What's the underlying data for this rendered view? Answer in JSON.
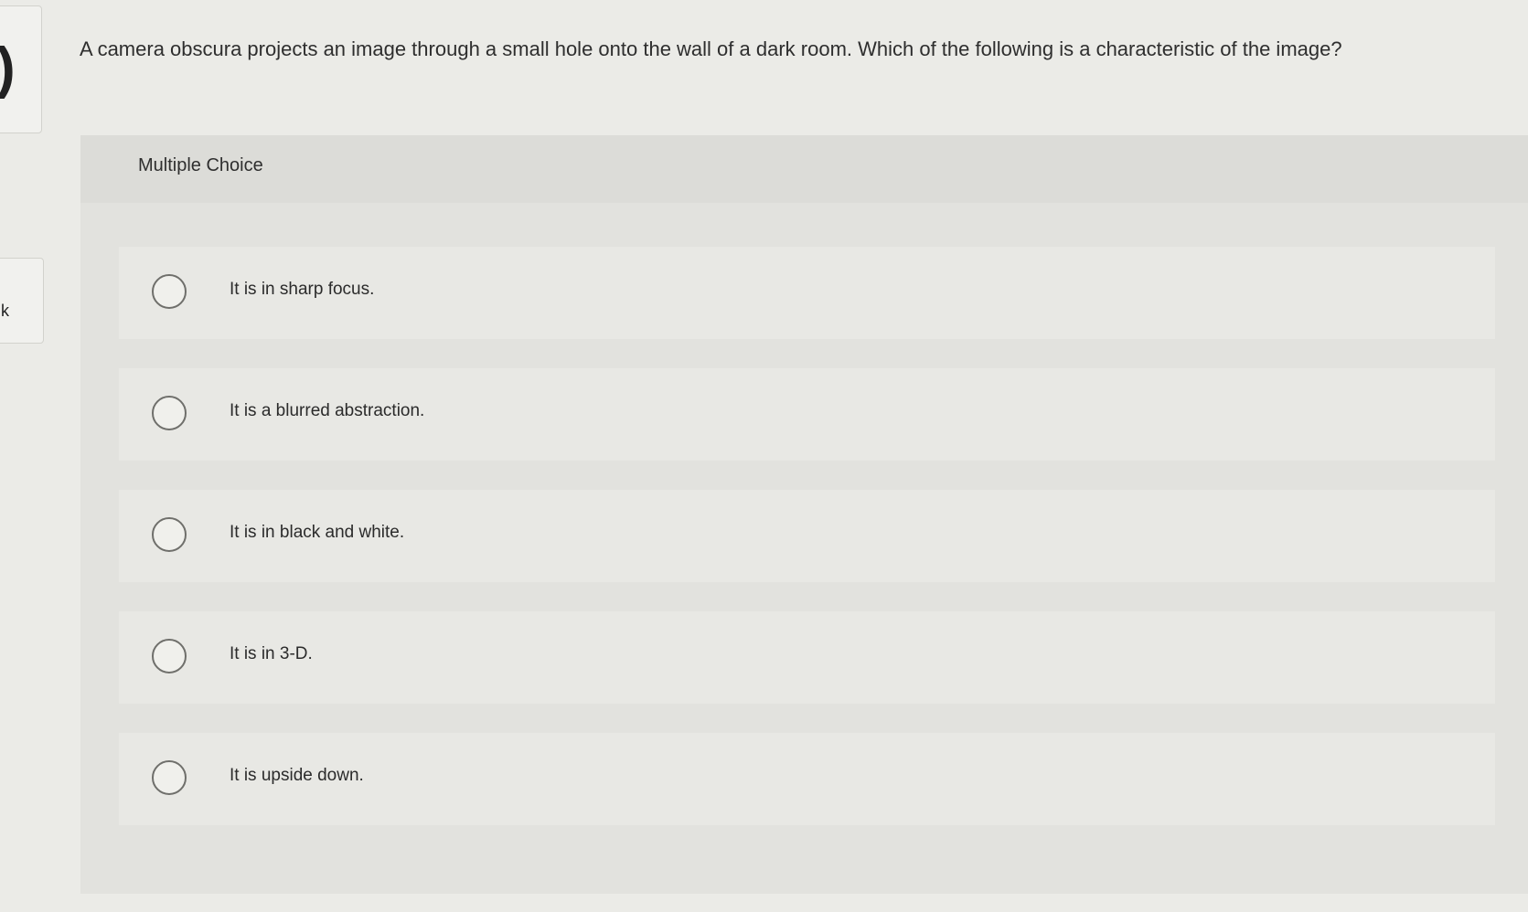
{
  "edge": {
    "top_glyph": ")",
    "mid_glyph": "k"
  },
  "question": {
    "text": "A camera obscura projects an image through a small hole onto the wall of a dark room.  Which of the following is a characteristic of the image?"
  },
  "multiple_choice": {
    "label": "Multiple Choice",
    "options": [
      {
        "label": "It is in sharp focus."
      },
      {
        "label": "It is a blurred abstraction."
      },
      {
        "label": "It is in black and white."
      },
      {
        "label": "It is in 3-D."
      },
      {
        "label": "It is upside down."
      }
    ]
  },
  "colors": {
    "page_bg": "#ebebe7",
    "panel_bg": "#e2e2de",
    "choice_bg": "#e8e8e4",
    "radio_border": "#6f6f6b",
    "text": "#2b2b2b"
  }
}
